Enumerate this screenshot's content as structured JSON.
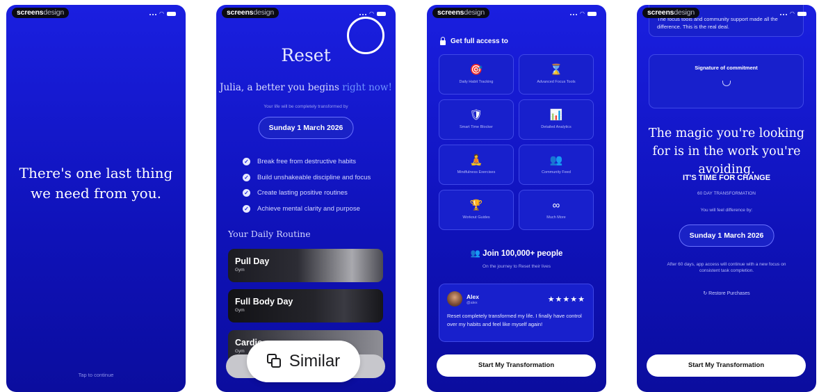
{
  "brand": {
    "bold": "screens",
    "light": "design"
  },
  "screen1": {
    "message": "There's one last thing we need from you.",
    "tap": "Tap to continue"
  },
  "screen2": {
    "title": "Reset",
    "subtitle": "Julia, a better you begins",
    "subtitle_accent": "right now!",
    "small": "Your life will be completely transformed by",
    "date": "Sunday 1 March 2026",
    "benefits": [
      "Break free from destructive habits",
      "Build unshakeable discipline and focus",
      "Create lasting positive routines",
      "Achieve mental clarity and purpose"
    ],
    "routine_heading": "Your Daily Routine",
    "routines": [
      {
        "title": "Pull Day",
        "sub": "Gym"
      },
      {
        "title": "Full Body Day",
        "sub": "Gym"
      },
      {
        "title": "Cardio",
        "sub": "Gym"
      }
    ]
  },
  "similar": {
    "label": "Similar"
  },
  "screen3": {
    "access": "Get full access to",
    "features": [
      {
        "icon": "🎯",
        "label": "Daily Habit Tracking",
        "name": "target-icon"
      },
      {
        "icon": "⌛",
        "label": "Advanced Focus Tools",
        "name": "hourglass-icon"
      },
      {
        "icon": "🛡",
        "label": "Smart Time Blocker",
        "name": "shield-icon"
      },
      {
        "icon": "📊",
        "label": "Detailed Analytics",
        "name": "bar-chart-icon"
      },
      {
        "icon": "🧘",
        "label": "Mindfulness Exercises",
        "name": "meditation-icon"
      },
      {
        "icon": "👥",
        "label": "Community Feed",
        "name": "people-icon"
      },
      {
        "icon": "🏆",
        "label": "Workout Guides",
        "name": "trophy-icon"
      },
      {
        "icon": "∞",
        "label": "Much More",
        "name": "infinity-icon"
      }
    ],
    "join": "Join 100,000+ people",
    "join_icon": "👥",
    "join_sub": "On the journey to Reset their lives",
    "review": {
      "name": "Alex",
      "handle": "@alex",
      "stars": "★★★★★",
      "text": "Reset completely transformed my life. I finally have control over my habits and feel like myself again!"
    },
    "cta": "Start My Transformation"
  },
  "screen4": {
    "top_text": "The focus tools and community support made all the difference. This is the real deal.",
    "signature_title": "Signature of commitment",
    "quote": "The magic you're looking for is in the work you're avoiding.",
    "change": "IT'S TIME FOR CHANGE",
    "sixty": "60 DAY TRANSFORMATION",
    "diff": "You will feel difference by:",
    "date": "Sunday 1 March 2026",
    "after": "After 60 days, app access will continue with a new focus on consistent task completion.",
    "restore": "Restore Purchases",
    "cta": "Start My Transformation"
  }
}
